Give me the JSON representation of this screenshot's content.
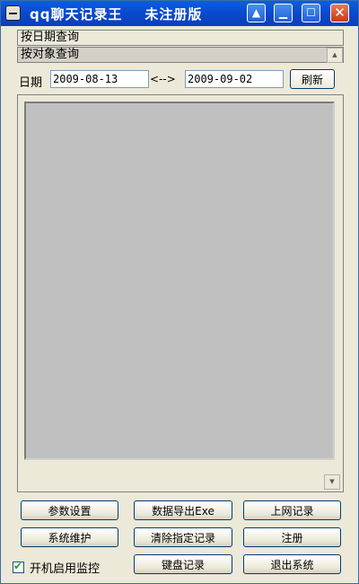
{
  "window": {
    "title": "qq聊天记录王    未注册版",
    "controls": {
      "help": "▲",
      "minimize": "▁",
      "maximize": "☐",
      "close": "✕"
    }
  },
  "panels": {
    "by_date": "按日期查询",
    "by_object": "按对象查询",
    "scroll_up": "▲",
    "scroll_down": "▼"
  },
  "date_filter": {
    "label": "日期",
    "start": "2009-08-13",
    "separator": "<-->",
    "end": "2009-09-02",
    "refresh": "刷新"
  },
  "buttons": {
    "settings": "参数设置",
    "export": "数据导出Exe",
    "web_log": "上网记录",
    "maintenance": "系统维护",
    "clear": "清除指定记录",
    "register": "注册",
    "keyboard": "键盘记录",
    "exit": "退出系统"
  },
  "autostart": {
    "label": "开机启用监控",
    "checked": true
  },
  "colors": {
    "titlebar": "#0a4ad0",
    "window_bg": "#ece9d8",
    "list_bg": "#c0c0c0",
    "close_btn": "#c8381a"
  }
}
